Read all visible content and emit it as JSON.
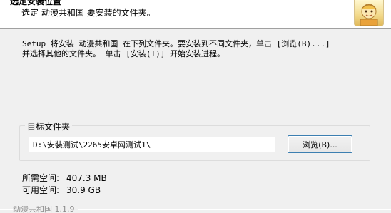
{
  "header": {
    "title": "选定安装位置",
    "subtitle": "选定 动漫共和国 要安装的文件夹。",
    "icon": "app-mascot-icon"
  },
  "description": {
    "line1": "Setup 将安装 动漫共和国 在下列文件夹。要安装到不同文件夹，单击 [浏览(B)...]",
    "line2": "并选择其他的文件夹。 单击 [安装(I)] 开始安装进程。"
  },
  "destination": {
    "group_label": "目标文件夹",
    "path_value": "D:\\安装测试\\2265安卓网测试1\\",
    "browse_label": "浏览(B)..."
  },
  "space": {
    "required_label": "所需空间:",
    "required_value": "407.3 MB",
    "available_label": "可用空间:",
    "available_value": "30.9 GB"
  },
  "branding": {
    "text": "动漫共和国 1.1.9"
  }
}
